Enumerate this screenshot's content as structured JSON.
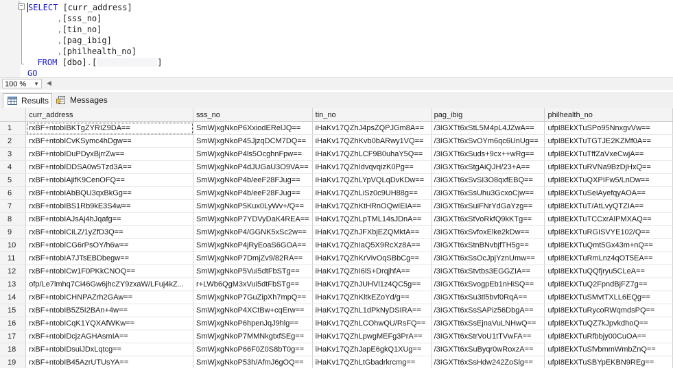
{
  "editor": {
    "lines": [
      {
        "parts": [
          {
            "t": "SELECT",
            "c": "kw"
          },
          {
            "t": " [curr_address]",
            "c": "ident"
          }
        ]
      },
      {
        "parts": [
          {
            "t": "      ,",
            "c": "gray"
          },
          {
            "t": "[sss_no]",
            "c": "ident"
          }
        ]
      },
      {
        "parts": [
          {
            "t": "      ,",
            "c": "gray"
          },
          {
            "t": "[tin_no]",
            "c": "ident"
          }
        ]
      },
      {
        "parts": [
          {
            "t": "      ,",
            "c": "gray"
          },
          {
            "t": "[pag_ibig]",
            "c": "ident"
          }
        ]
      },
      {
        "parts": [
          {
            "t": "      ,",
            "c": "gray"
          },
          {
            "t": "[philhealth_no]",
            "c": "ident"
          }
        ]
      },
      {
        "parts": [
          {
            "t": "  FROM",
            "c": "kw"
          },
          {
            "t": " [dbo]",
            "c": "ident"
          },
          {
            "t": ".",
            "c": "gray"
          },
          {
            "t": "[",
            "c": "ident"
          },
          {
            "redact": true
          },
          {
            "t": "]",
            "c": "ident"
          }
        ]
      },
      {
        "parts": [
          {
            "t": "GO",
            "c": "kw"
          }
        ]
      }
    ]
  },
  "zoom": "100 %",
  "tabs": {
    "results": "Results",
    "messages": "Messages"
  },
  "grid": {
    "columns": [
      "curr_address",
      "sss_no",
      "tin_no",
      "pag_ibig",
      "philhealth_no"
    ],
    "rows": [
      [
        "1",
        "rxBF+ntobIBKTgZYRIZ9DA==",
        "SmWjxgNkoP6XxiodERelJQ==",
        "iHaKv17QZhJ4psZQPJGm8A==",
        "/3IGXTt6xStL5M4pL4JZwA==",
        "ufpI8EkXTuSPo95NnxgvVw=="
      ],
      [
        "2",
        "rxBF+ntobICvKSymc4hDgw==",
        "SmWjxgNkoP45JjzqDCM7DQ==",
        "iHaKv17QZhKvb0bARwy1VQ==",
        "/3IGXTt6xSvOYm6qc6UnUg==",
        "ufpI8EkXTuTGTJE2KZMf0A=="
      ],
      [
        "3",
        "rxBF+ntobIDuPDyxBjrrZw==",
        "SmWjxgNkoP4ls5OcghnFpw==",
        "iHaKv17QZhLCF9B0uhaY5Q==",
        "/3IGXTt6xSuds+9cx++wRg==",
        "ufpI8EkXTuTffZaVxeCwjA=="
      ],
      [
        "4",
        "rxBF+ntobIDDSA0w5Tzd3A==",
        "SmWjxgNkoP4dJUGaU3O9VA==",
        "iHaKv17QZhIdvqvqizK0Pg==",
        "/3IGXTt6xStgAiQJH/23+A==",
        "ufpI8EkXTuRVNa9BzDjHxQ=="
      ],
      [
        "5",
        "rxBF+ntobIAjifK9CenOFQ==",
        "SmWjxgNkoP4b/eeF28FJug==",
        "iHaKv17QZhLYpVQLqDvKDw==",
        "/3IGXTt6xSvSI3O8qxfEBQ==",
        "ufpI8EkXTuQXPIFw5/LnDw=="
      ],
      [
        "6",
        "rxBF+ntobIAbBQU3qxBkGg==",
        "SmWjxgNkoP4b/eeF28FJug==",
        "iHaKv17QZhLiSz0c9UH88g==",
        "/3IGXTt6xSsUhu3GcxoCjw==",
        "ufpI8EkXTuSeiAyefqyAOA=="
      ],
      [
        "7",
        "rxBF+ntobIBS1Rb9kE3S4w==",
        "SmWjxgNkoP5Kux0LyWv+/Q==",
        "iHaKv17QZhKtHRnOQwIEIA==",
        "/3IGXTt6xSuiFNrYdGaYzg==",
        "ufpI8EkXTuT/AtLvyQTZIA=="
      ],
      [
        "8",
        "rxBF+ntobIAJsAj4hJqafg==",
        "SmWjxgNkoP7YDVyDaK4REA==",
        "iHaKv17QZhLpTML14sJDnA==",
        "/3IGXTt6xStVoRkfQ9kKTg==",
        "ufpI8EkXTuTCCxrAlPMXAQ=="
      ],
      [
        "9",
        "rxBF+ntobICiLZ/1yZfD3Q==",
        "SmWjxgNkoP4/GGNK5xSc2w==",
        "iHaKv17QZhJFXbjEZQMktA==",
        "/3IGXTt6xSvfoxElke2kDw==",
        "ufpI8EkXTuRGISVYE102/Q=="
      ],
      [
        "10",
        "rxBF+ntobICG6rPsOY/h6w==",
        "SmWjxgNkoP4jRyEoaS6GOA==",
        "iHaKv17QZhIaQ5X9RcXz8A==",
        "/3IGXTt6xStnBNvbjfTH5g==",
        "ufpI8EkXTuQmt5Gx43m+nQ=="
      ],
      [
        "11",
        "rxBF+ntobIA7JTsEBDbegw==",
        "SmWjxgNkoP7DmjZv9/82RA==",
        "iHaKv17QZhKrVivOqSBbCg==",
        "/3IGXTt6xSsOcJpjYznUmw==",
        "ufpI8EkXTuRmLnz4qOT5EA=="
      ],
      [
        "12",
        "rxBF+ntobICw1F0PKkCNOQ==",
        "SmWjxgNkoP5Vui5dtFbSTg==",
        "iHaKv17QZhI6lS+DrqjhfA==",
        "/3IGXTt6xStvtbs3EGGZIA==",
        "ufpI8EkXTuQQfjryu5CLeA=="
      ],
      [
        "13",
        "ofp/Le7lmhq7Ci46Gw6jhcZY9zxaW/LFuj4kZ...",
        "r+LWb6QgM3xVui5dtFbSTg==",
        "iHaKv17QZhJUHVl1z4QC5g==",
        "/3IGXTt6xSvogpEb1nHiSQ==",
        "ufpI8EkXTuQ2FpndBjFZ7g=="
      ],
      [
        "14",
        "rxBF+ntobICHNPAZrh2GAw==",
        "SmWjxgNkoP7GuZipXh7mpQ==",
        "iHaKv17QZhKltkEZoYd/g==",
        "/3IGXTt6xSu3tl5bvf0RqA==",
        "ufpI8EkXTuSMvtTXLL6EQg=="
      ],
      [
        "15",
        "rxBF+ntobIB5Z5I2BAn+4w==",
        "SmWjxgNkoP4XCtBw+cqErw==",
        "iHaKv17QZhL1dPkNyDSIRA==",
        "/3IGXTt6xSsSAPiz56DbgA==",
        "ufpI8EkXTuRycoRWqmdsPQ=="
      ],
      [
        "16",
        "rxBF+ntobICqK1YQXAfWKw==",
        "SmWjxgNkoP6hpenJqJ9hlg==",
        "iHaKv17QZhLCOhwQU/RsFQ==",
        "/3IGXTt6xSsEjnaVuLNHwQ==",
        "ufpI8EkXTuQZ7kJpvkdhoQ=="
      ],
      [
        "17",
        "rxBF+ntobIDcjzAGHAsmIA==",
        "SmWjxgNkoP7MMNkgtxfSEg==",
        "iHaKv17QZhLpwgMEFg3PrA==",
        "/3IGXTt6xStrVoU1tTVwFA==",
        "ufpI8EkXTuRfbbjy00CuOA=="
      ],
      [
        "18",
        "rxBF+ntobIDsuiJDxLqtcg==",
        "SmWjxgNkoP66F0Z0S8bT0g==",
        "iHaKv17QZhJapE6gkQ1XUg==",
        "/3IGXTt6xSuByqr0wRoxzA==",
        "ufpI8EkXTuSfvbmmWmbZnQ=="
      ],
      [
        "19",
        "rxBF+ntobIB45AzrUTUsYA==",
        "SmWjxgNkoP53h/AfmJ6gOQ==",
        "iHaKv17QZhLtGbadrkrcmg==",
        "/3IGXTt6xSsHdw242ZoSlg==",
        "ufpI8EkXTuSBYpEKBN9REg=="
      ]
    ]
  }
}
